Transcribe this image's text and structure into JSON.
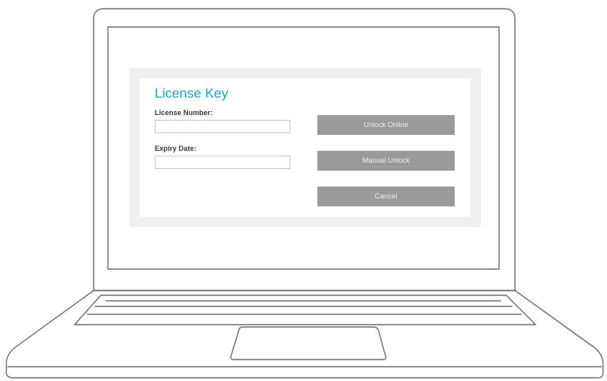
{
  "dialog": {
    "title": "License Key",
    "fields": {
      "license_number": {
        "label": "License Number:",
        "value": "",
        "placeholder": ""
      },
      "expiry_date": {
        "label": "Expiry Date:",
        "value": "",
        "placeholder": ""
      }
    },
    "buttons": {
      "unlock_online": "Unlock Online",
      "manual_unlock": "Manual Unlock",
      "cancel": "Cancel"
    }
  },
  "colors": {
    "title_accent": "#1aa3d9",
    "button_background": "#9a9a9a",
    "button_text": "#eeeeee",
    "dialog_frame": "#efefef",
    "laptop_outline": "#6f6f6f"
  }
}
